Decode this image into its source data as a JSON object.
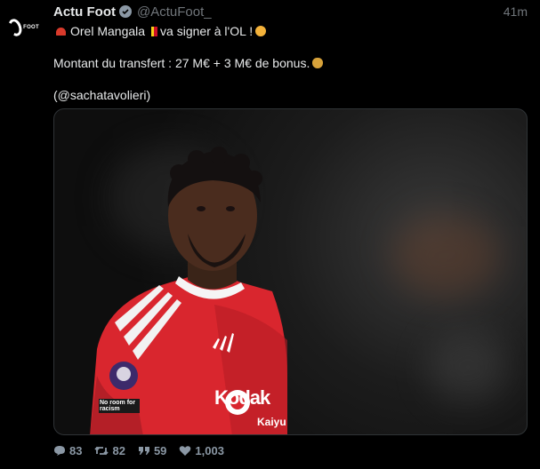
{
  "account": {
    "name": "Actu Foot",
    "handle": "@ActuFoot_",
    "time": "41m",
    "avatar_text": "FOOT"
  },
  "tweet": {
    "line1": "Orel Mangala",
    "line1_suffix": "va signer à l'OL !",
    "line2": "Montant du transfert : 27 M€ + 3 M€ de bonus.",
    "line3": "(@sachatavolieri)"
  },
  "media": {
    "shirt_text_1": "Kodak",
    "shirt_text_2": "No room for racism",
    "shirt_text_3": "Kaiyu"
  },
  "actions": {
    "replies": "83",
    "retweets": "82",
    "quotes": "59",
    "likes": "1,003"
  },
  "colors": {
    "background": "#000000",
    "text": "#e7e9ea",
    "muted": "#71767b",
    "shirt_red": "#d9262e"
  },
  "icons": [
    "siren-emoji",
    "belgium-flag",
    "lion-emoji",
    "moneybag-emoji",
    "verified-icon",
    "reply-icon",
    "retweet-icon",
    "quote-icon",
    "like-icon"
  ]
}
